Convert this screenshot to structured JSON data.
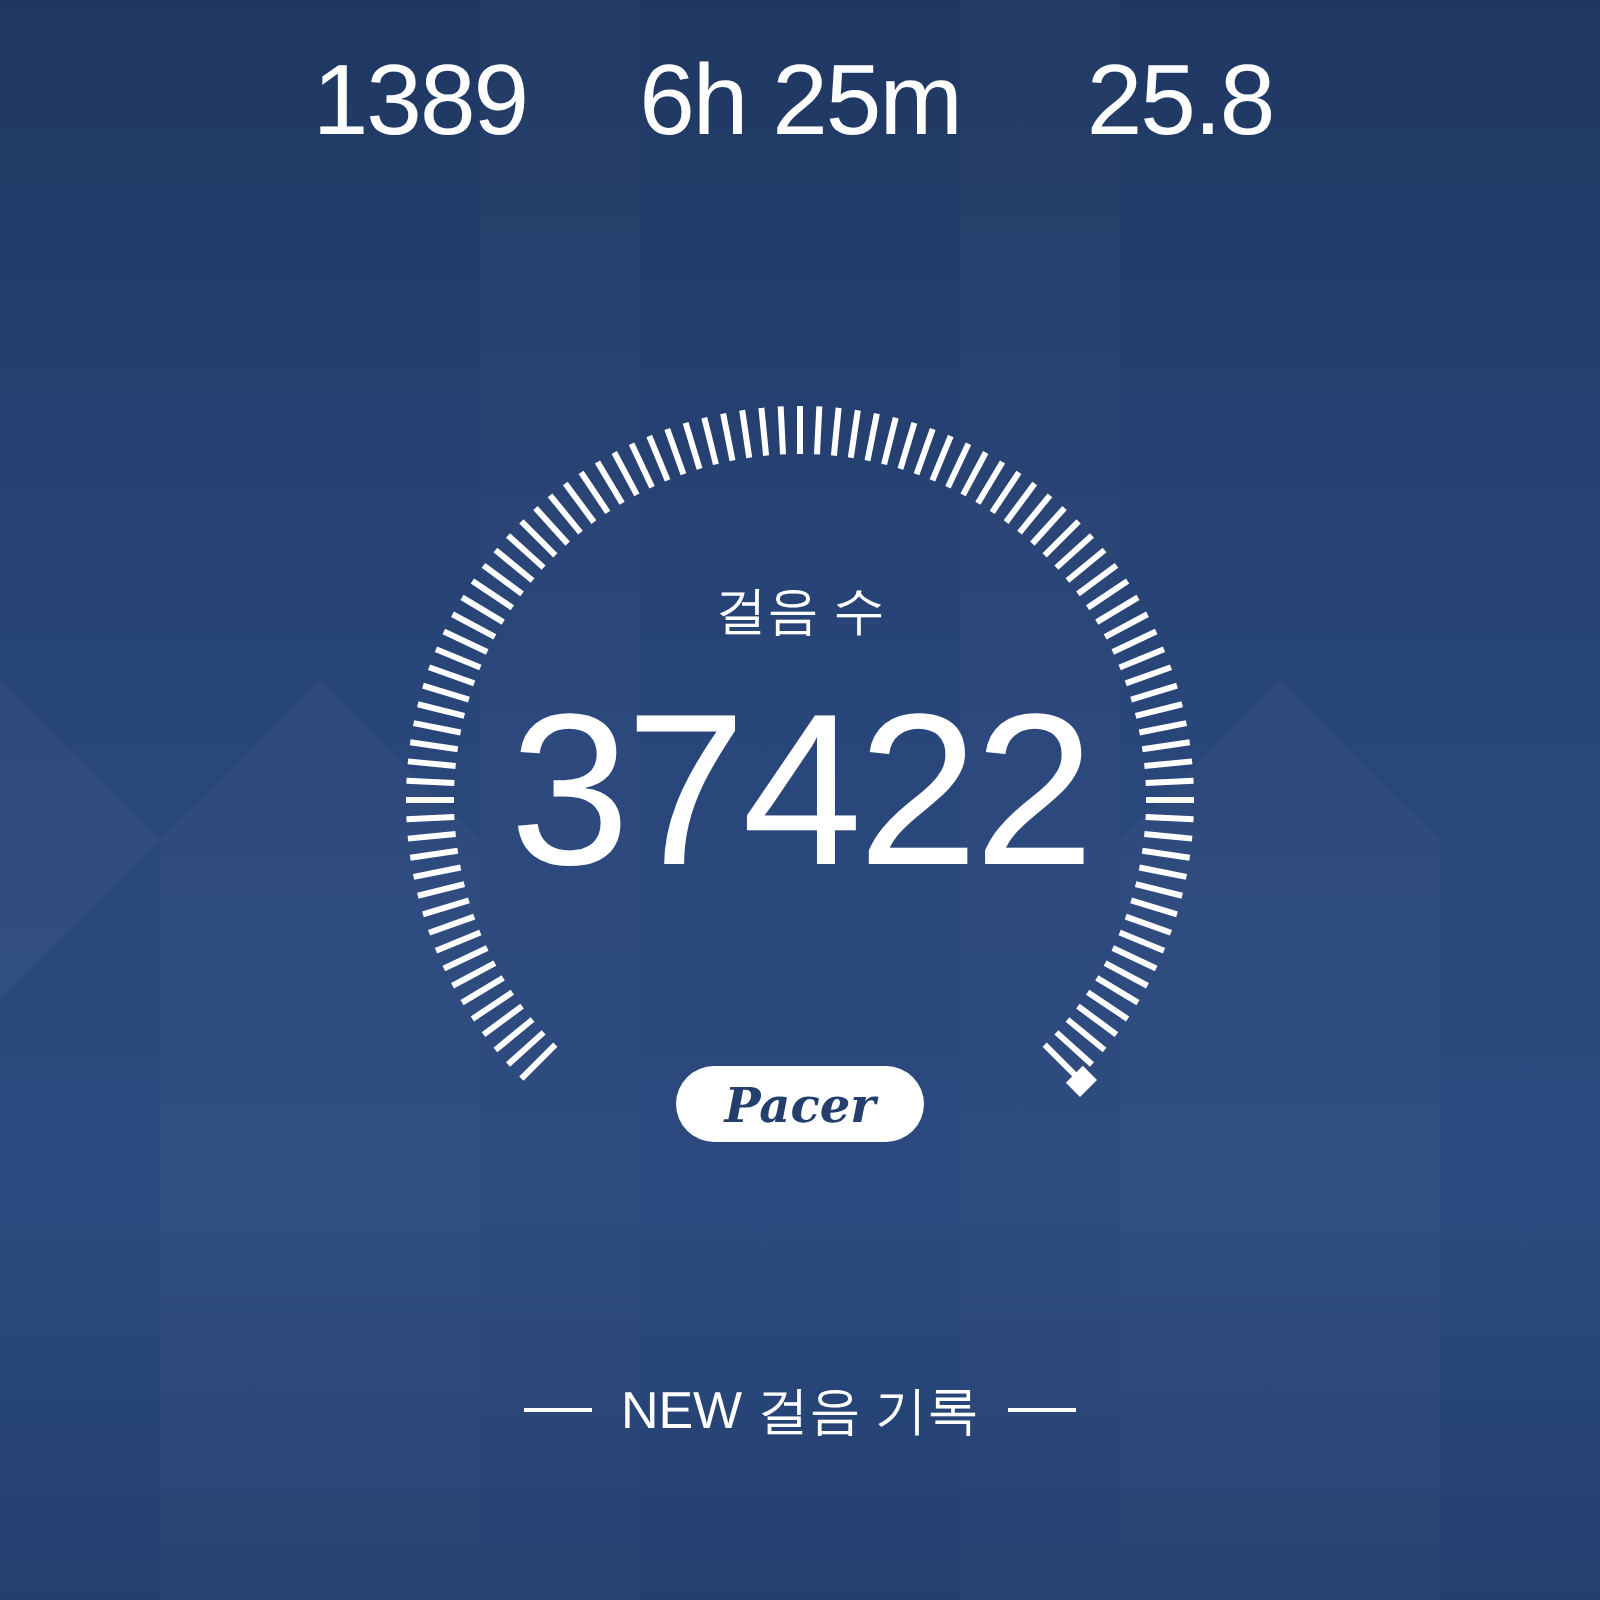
{
  "stats": [
    {
      "value": "1389"
    },
    {
      "value": "6h 25m"
    },
    {
      "value": "25.8"
    }
  ],
  "gauge": {
    "label": "걸음 수",
    "value": "37422"
  },
  "badge": {
    "text": "Pacer"
  },
  "footer": {
    "text": "NEW 걸음 기록"
  }
}
